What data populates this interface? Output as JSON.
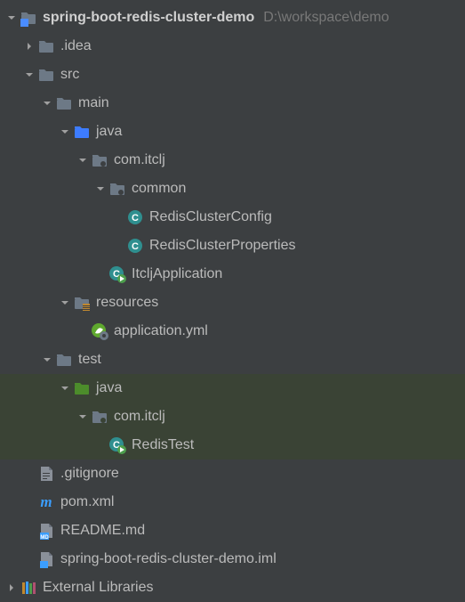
{
  "project": {
    "name": "spring-boot-redis-cluster-demo",
    "path": "D:\\workspace\\demo"
  },
  "tree": {
    "idea": ".idea",
    "src": "src",
    "main": "main",
    "java_main": "java",
    "pkg_main": "com.itclj",
    "common": "common",
    "redisClusterConfig": "RedisClusterConfig",
    "redisClusterProperties": "RedisClusterProperties",
    "itcljApplication": "ItcljApplication",
    "resources": "resources",
    "applicationYml": "application.yml",
    "test": "test",
    "java_test": "java",
    "pkg_test": "com.itclj",
    "redisTest": "RedisTest",
    "gitignore": ".gitignore",
    "pom": "pom.xml",
    "readme": "README.md",
    "iml": "spring-boot-redis-cluster-demo.iml",
    "external": "External Libraries"
  },
  "indent_unit": 20
}
